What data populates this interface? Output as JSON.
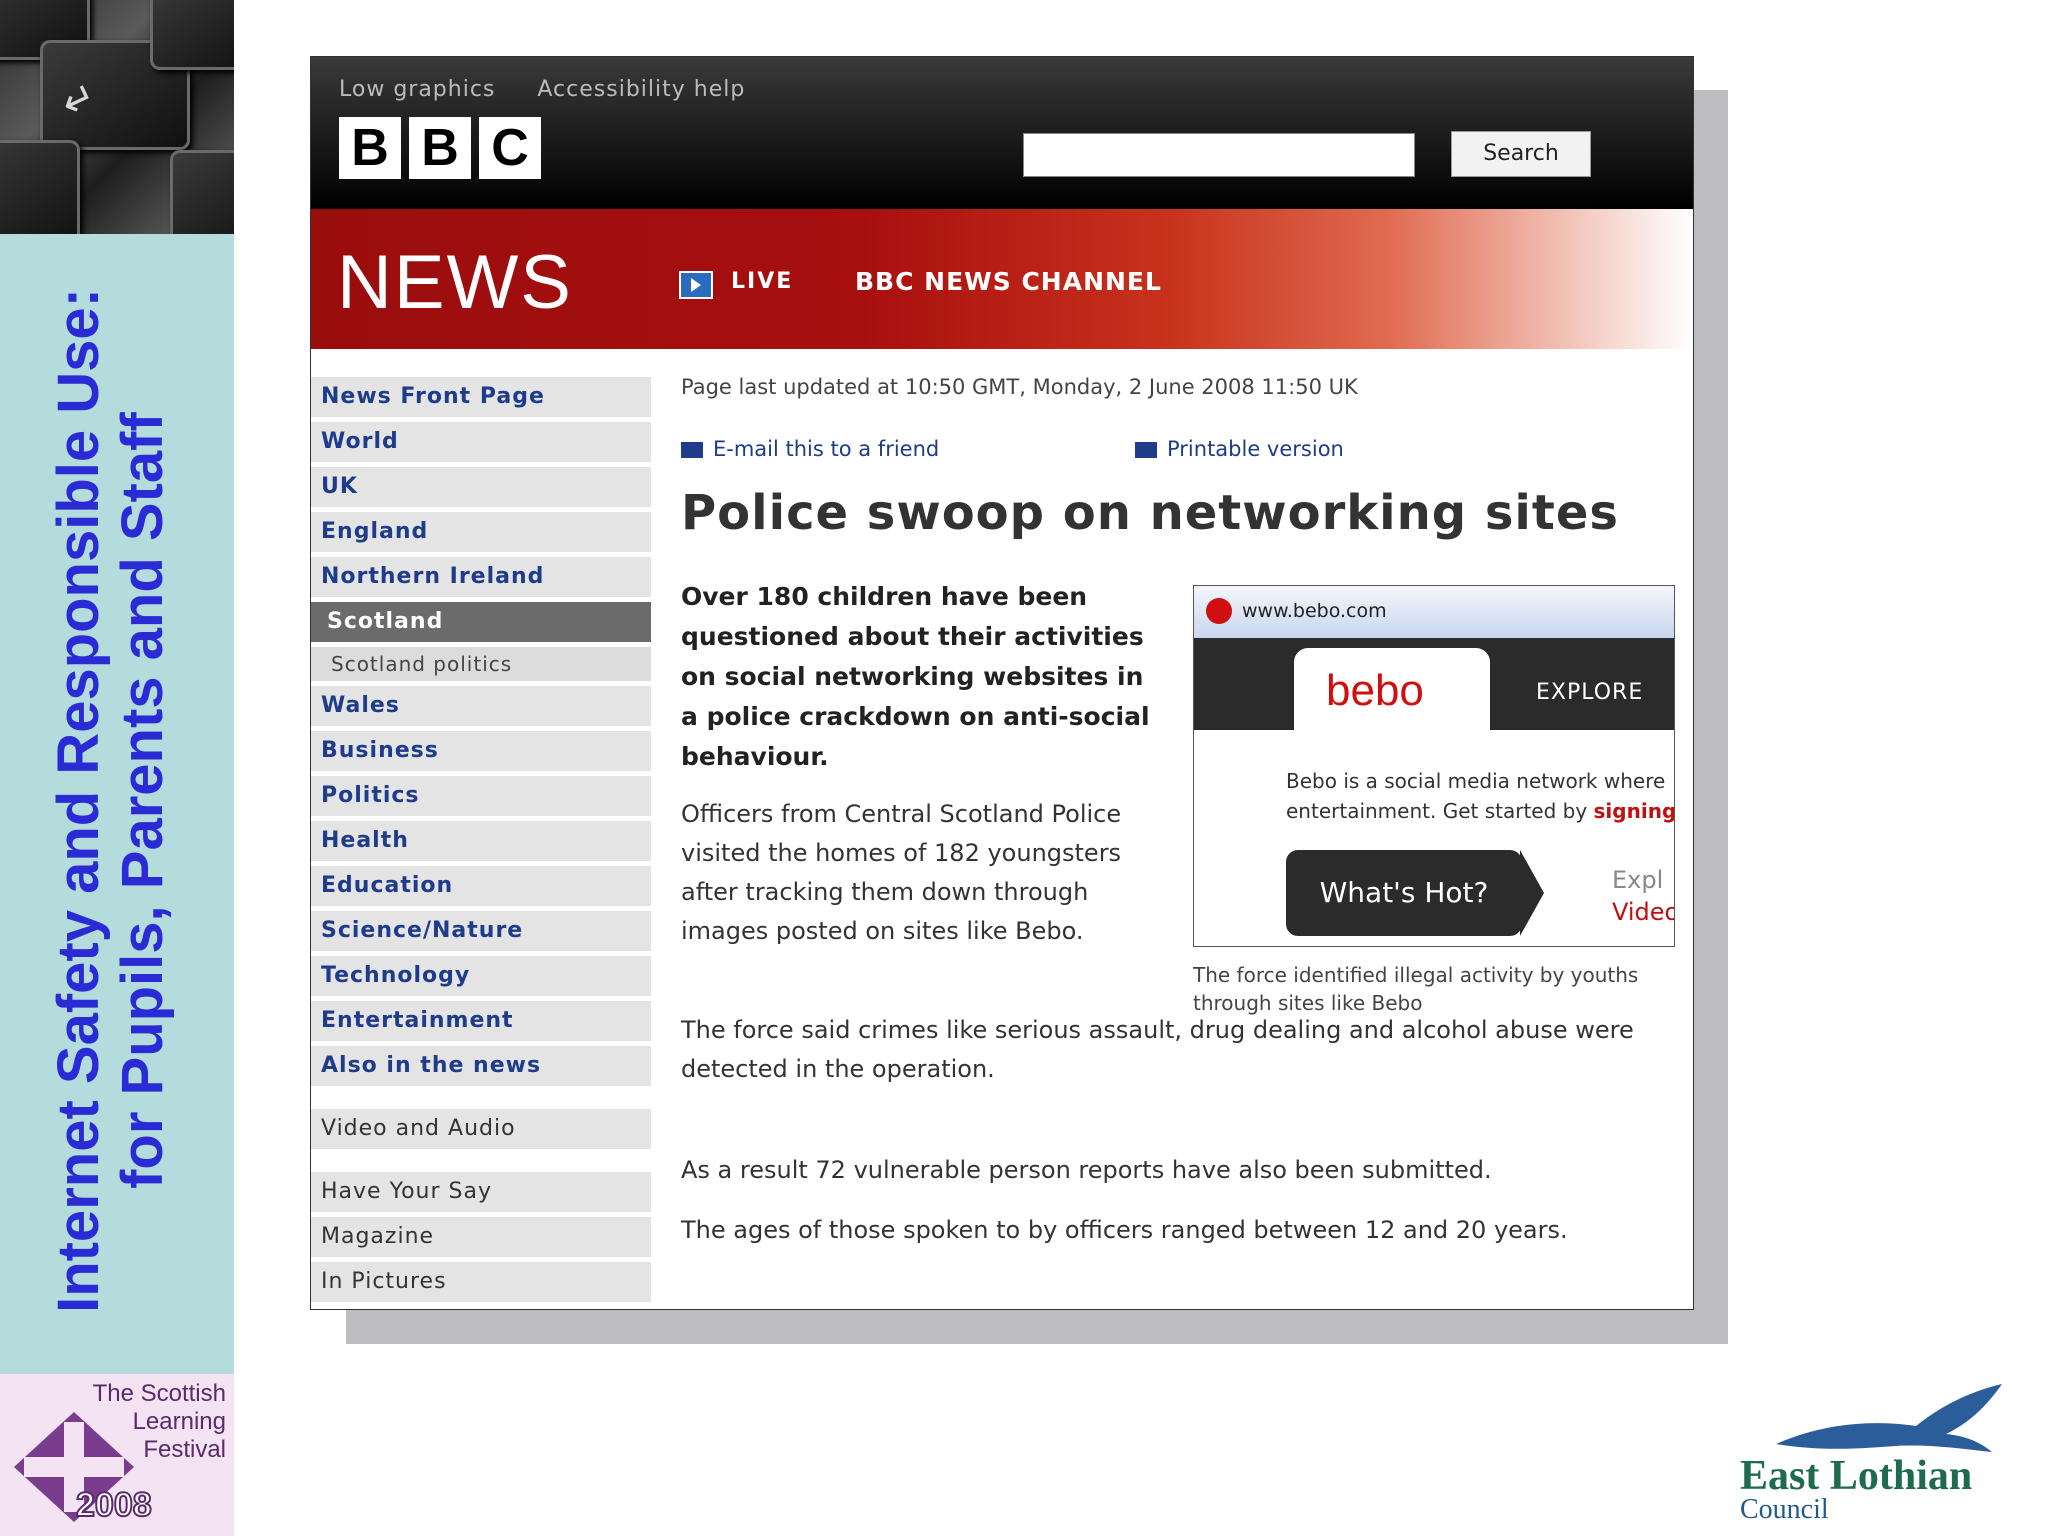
{
  "slide": {
    "title_line1": "Internet Safety and Responsible Use:",
    "title_line2": "for Pupils, Parents and Staff",
    "festival_text": "The Scottish Learning Festival",
    "festival_year": "2008",
    "council_name": "East Lothian",
    "council_suffix": "Council"
  },
  "bbc": {
    "top_links": [
      "Low graphics",
      "Accessibility help"
    ],
    "logo_letters": [
      "B",
      "B",
      "C"
    ],
    "search_placeholder": "",
    "search_label": "Search",
    "section_title": "NEWS",
    "live_label": "LIVE",
    "channel_label": "BBC NEWS CHANNEL"
  },
  "nav": {
    "items": [
      "News Front Page",
      "World",
      "UK",
      "England",
      "Northern Ireland",
      "Scotland",
      "Scotland politics",
      "Wales",
      "Business",
      "Politics",
      "Health",
      "Education",
      "Science/Nature",
      "Technology",
      "Entertainment",
      "Also in the news",
      "Video and Audio",
      "Have Your Say",
      "Magazine",
      "In Pictures"
    ],
    "selected": "Scotland"
  },
  "article": {
    "updated": "Page last updated at 10:50 GMT, Monday, 2 June 2008 11:50 UK",
    "email_link": "E-mail this to a friend",
    "print_link": "Printable version",
    "headline": "Police swoop on networking sites",
    "intro": "Over 180 children have been questioned about their activities on social networking websites in a police crackdown on anti-social behaviour.",
    "para1": "Officers from Central Scotland Police visited the homes of 182 youngsters after tracking them down through images posted on sites like Bebo.",
    "para2": "The force said crimes like serious assault, drug dealing and alcohol abuse were detected in the operation.",
    "para3": "As a result 72 vulnerable person reports have also been submitted.",
    "para4": "The ages of those spoken to by officers ranged between 12 and 20 years.",
    "caption": "The force identified illegal activity by youths through sites like Bebo"
  },
  "bebo": {
    "url": "www.bebo.com",
    "logo": "bebo",
    "explore": "EXPLORE",
    "desc_line1": "Bebo is a social media network where",
    "desc_line2_plain": "entertainment. Get started by",
    "desc_line2_link": "signing",
    "hot_button": "What's Hot?",
    "side_1": "Expl",
    "side_2": "Video"
  },
  "colors": {
    "bbc_red": "#a80f0f",
    "nav_link": "#1e3c8a",
    "slide_title": "#2b2bd6",
    "sidebar_bg": "#b4dcdc"
  }
}
